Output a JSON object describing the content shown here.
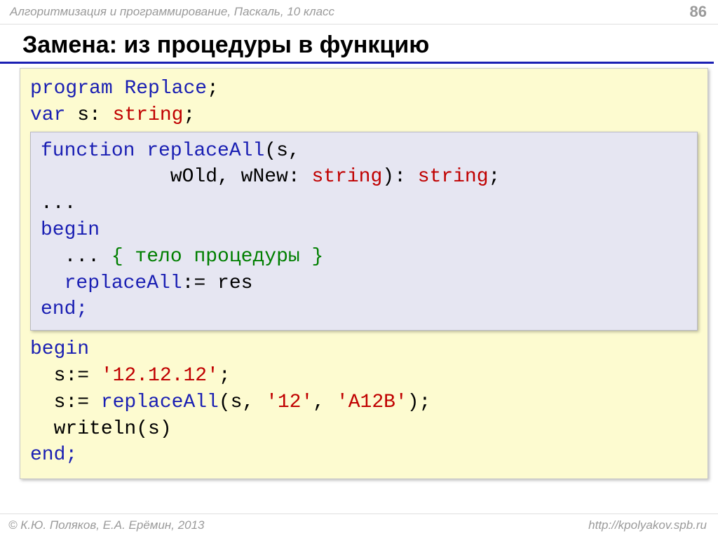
{
  "header": {
    "course": "Алгоритмизация и программирование, Паскаль, 10 класс",
    "page": "86"
  },
  "title": "Замена: из процедуры в функцию",
  "outer": {
    "l1_kw": "program",
    "l1_name": "Replace",
    "l1_semi": ";",
    "l2_kw": "var",
    "l2_var": " s: ",
    "l2_type": "string",
    "l2_semi": ";",
    "begin": "begin",
    "s1a": "  s:= ",
    "s1b": "'12.12.12'",
    "s1c": ";",
    "s2a": "  s:= ",
    "s2b": "replaceAll",
    "s2c": "(s, ",
    "s2d": "'12'",
    "s2e": ", ",
    "s2f": "'A12B'",
    "s2g": ");",
    "s3": "  writeln(s)",
    "end": "end;"
  },
  "inner": {
    "f1_kw": "function",
    "f1_name": "replaceAll",
    "f1_p1": "(s,",
    "f2_pad": "           wOld, wNew: ",
    "f2_t1": "string",
    "f2_mid": "): ",
    "f2_t2": "string",
    "f2_semi": ";",
    "dots1": "...",
    "begin": "begin",
    "body_a": "  ... ",
    "body_b": "{ тело процедуры }",
    "ret_a": "  ",
    "ret_b": "replaceAll",
    "ret_c": ":= res",
    "end": "end;"
  },
  "footer": {
    "left": "© К.Ю. Поляков, Е.А. Ерёмин, 2013",
    "right": "http://kpolyakov.spb.ru"
  }
}
